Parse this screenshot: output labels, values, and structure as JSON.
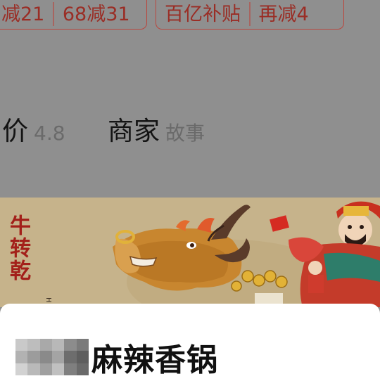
{
  "promo": {
    "tags": [
      {
        "text": "减21"
      },
      {
        "text": "68减31"
      },
      {
        "text": "百亿补贴"
      },
      {
        "text": "再减4"
      }
    ],
    "accent_color": "#b9473f"
  },
  "stats": {
    "rating": {
      "label": "价",
      "value": "4.8"
    },
    "merchant": {
      "label": "商家",
      "value": "故事"
    }
  },
  "banner": {
    "calligraphy": "牛转乾",
    "image": "new-year-ox-and-god-of-wealth-illustration"
  },
  "shop": {
    "name_blurred": "mosaic-blurred-text",
    "name": "麻辣香锅"
  },
  "colors": {
    "overlay": "#8f8f8f",
    "tag_text": "#9a2d25",
    "sheet": "#ffffff"
  }
}
